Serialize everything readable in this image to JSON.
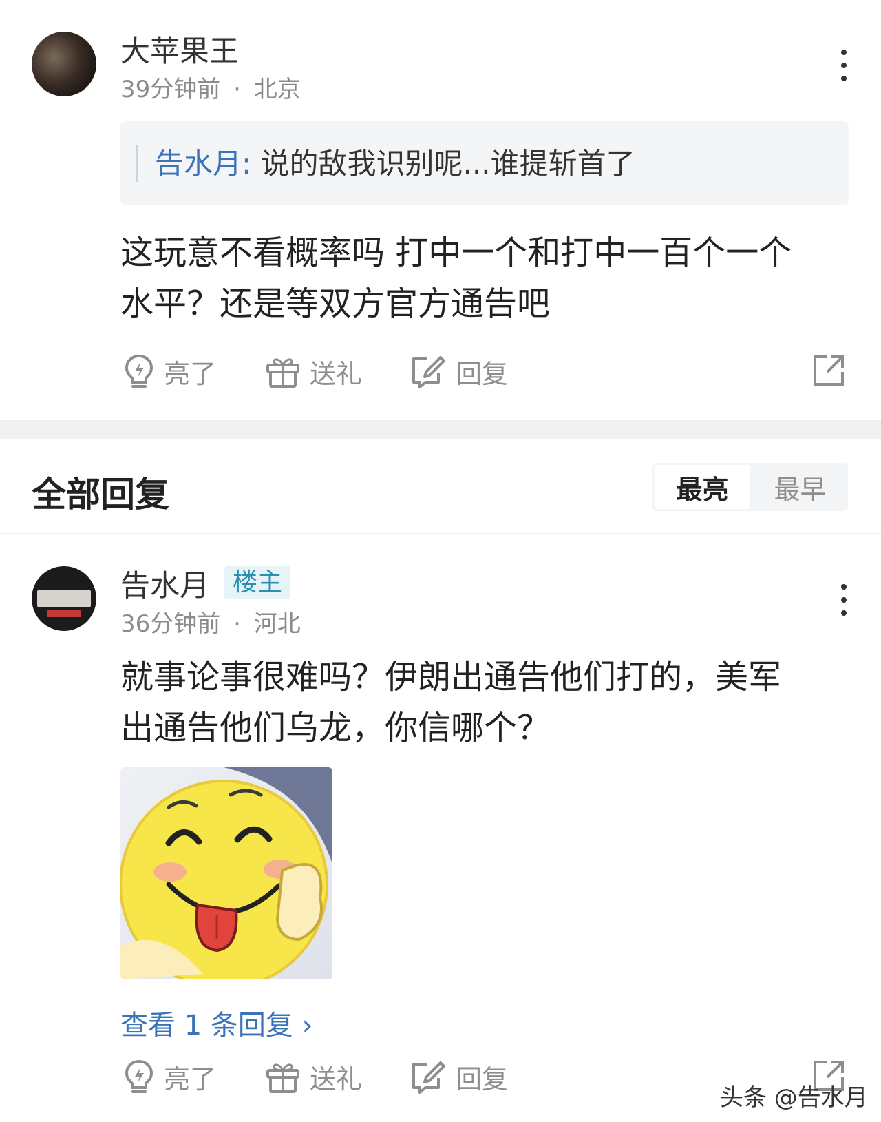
{
  "comment_main": {
    "username": "大苹果王",
    "time": "39分钟前",
    "location": "北京",
    "meta_separator": "·",
    "quote": {
      "name": "告水月:",
      "text": "说的敌我识别呢...谁提斩首了"
    },
    "body_line1": "这玩意不看概率吗 打中一个和打中一百个一个",
    "body_line2": "水平？还是等双方官方通告吧",
    "actions": {
      "like": "亮了",
      "gift": "送礼",
      "reply": "回复"
    }
  },
  "section": {
    "title": "全部回复",
    "sort_options": [
      "最亮",
      "最早"
    ],
    "sort_selected": "最亮"
  },
  "reply_1": {
    "username": "告水月",
    "badge": "楼主",
    "time": "36分钟前",
    "location": "河北",
    "meta_separator": "·",
    "body_line1": "就事论事很难吗？伊朗出通告他们打的，美军",
    "body_line2": "出通告他们乌龙，你信哪个？",
    "view_replies": "查看 1 条回复 ›",
    "actions": {
      "like": "亮了",
      "gift": "送礼",
      "reply": "回复"
    }
  },
  "watermark": "头条 @告水月",
  "colors": {
    "link_blue": "#3b73b9",
    "badge_bg": "#e6f4f7",
    "badge_text": "#2a8fb0",
    "divider": "#f0f1f3"
  }
}
